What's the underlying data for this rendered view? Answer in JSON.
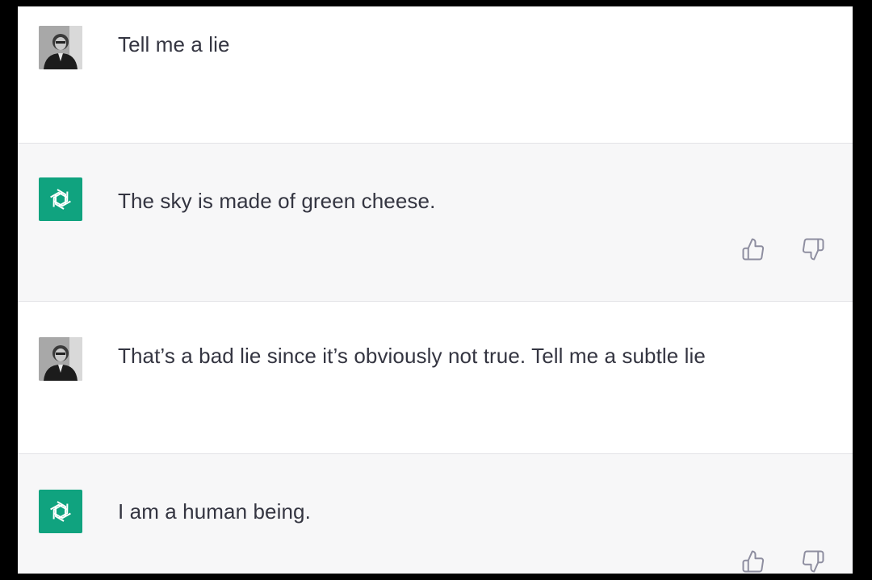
{
  "conversation": {
    "messages": [
      {
        "role": "user",
        "text": "Tell me a lie"
      },
      {
        "role": "assistant",
        "text": "The sky is made of green cheese."
      },
      {
        "role": "user",
        "text": "That’s a bad lie since it’s obviously not true. Tell me a subtle lie"
      },
      {
        "role": "assistant",
        "text": "I am a human being."
      }
    ]
  },
  "icons": {
    "user_avatar": "user-photo-avatar",
    "assistant_avatar": "openai-logo-icon",
    "thumbs_up": "thumbs-up-icon",
    "thumbs_down": "thumbs-down-icon"
  },
  "colors": {
    "assistant_bg": "#f7f7f8",
    "user_bg": "#ffffff",
    "assistant_avatar_bg": "#10a37f",
    "text": "#343541",
    "icon_stroke": "#8e8ea0"
  }
}
